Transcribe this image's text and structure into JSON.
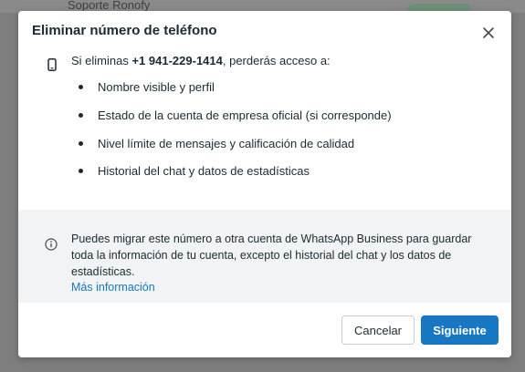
{
  "background": {
    "row_text": "Soporte Ronofy"
  },
  "dialog": {
    "title": "Eliminar número de teléfono",
    "intro_prefix": "Si eliminas ",
    "phone_number": "+1 941-229-1414",
    "intro_suffix": ", perderás acceso a:",
    "bullets": [
      "Nombre visible y perfil",
      "Estado de la cuenta de empresa oficial (si corresponde)",
      "Nivel límite de mensajes y calificación de calidad",
      "Historial del chat y datos de estadísticas"
    ],
    "info_text": "Puedes migrar este número a otra cuenta de WhatsApp Business para guardar toda la información de tu cuenta, excepto el historial del chat y los datos de estadísticas.",
    "info_link": "Más información",
    "cancel_label": "Cancelar",
    "next_label": "Siguiente",
    "icons": {
      "close": "close-icon",
      "phone": "phone-icon",
      "info": "info-icon"
    },
    "colors": {
      "primary": "#1877c2",
      "link": "#1877b8",
      "text": "#1c2b33",
      "info_band": "#f1f3f5"
    }
  }
}
